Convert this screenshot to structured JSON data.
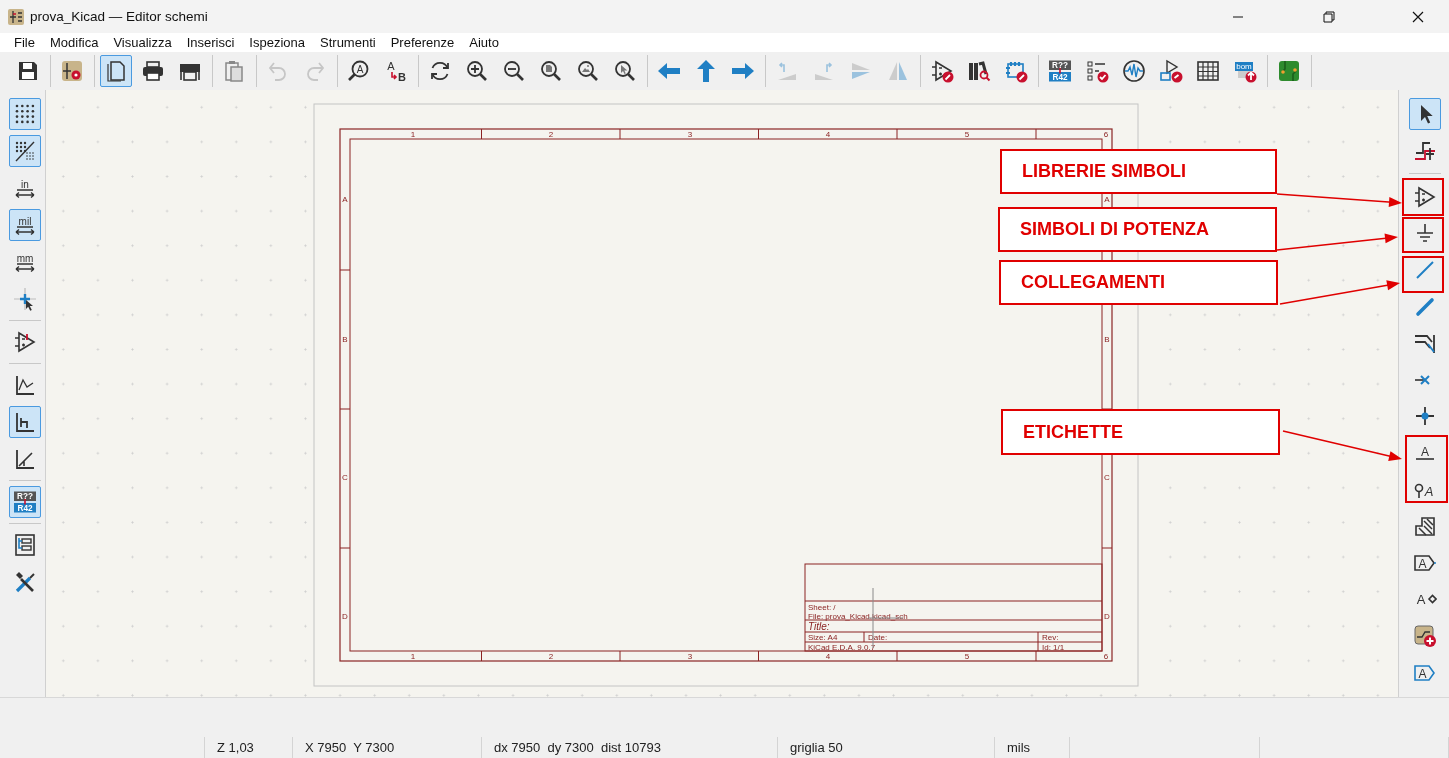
{
  "window": {
    "title": "prova_Kicad — Editor schemi"
  },
  "menu": [
    "File",
    "Modifica",
    "Visualizza",
    "Inserisci",
    "Ispeziona",
    "Strumenti",
    "Preferenze",
    "Aiuto"
  ],
  "toolbar": [
    {
      "kind": "save",
      "selected": false,
      "disabled": false
    },
    {
      "kind": "separator"
    },
    {
      "kind": "setup",
      "selected": false,
      "disabled": false
    },
    {
      "kind": "separator"
    },
    {
      "kind": "page",
      "selected": true,
      "disabled": false
    },
    {
      "kind": "print",
      "selected": false,
      "disabled": false
    },
    {
      "kind": "plot",
      "selected": false,
      "disabled": false
    },
    {
      "kind": "separator"
    },
    {
      "kind": "paste",
      "selected": false,
      "disabled": false
    },
    {
      "kind": "separator"
    },
    {
      "kind": "undo",
      "selected": false,
      "disabled": true
    },
    {
      "kind": "redo",
      "selected": false,
      "disabled": true
    },
    {
      "kind": "separator"
    },
    {
      "kind": "find",
      "selected": false,
      "disabled": false,
      "glyphs": [
        "A"
      ]
    },
    {
      "kind": "replace",
      "selected": false,
      "disabled": false,
      "glyphs": [
        "A",
        "B"
      ]
    },
    {
      "kind": "separator"
    },
    {
      "kind": "refresh",
      "selected": false,
      "disabled": false
    },
    {
      "kind": "zoom-in",
      "selected": false,
      "disabled": false
    },
    {
      "kind": "zoom-out",
      "selected": false,
      "disabled": false
    },
    {
      "kind": "zoom-fit",
      "selected": false,
      "disabled": false
    },
    {
      "kind": "zoom-objects",
      "selected": false,
      "disabled": false
    },
    {
      "kind": "zoom-selection",
      "selected": false,
      "disabled": false
    },
    {
      "kind": "separator"
    },
    {
      "kind": "pan-left",
      "selected": false,
      "disabled": false
    },
    {
      "kind": "pan-up",
      "selected": false,
      "disabled": false
    },
    {
      "kind": "pan-right",
      "selected": false,
      "disabled": false
    },
    {
      "kind": "separator"
    },
    {
      "kind": "rotate-ccw",
      "selected": false,
      "disabled": true
    },
    {
      "kind": "rotate-cw",
      "selected": false,
      "disabled": true
    },
    {
      "kind": "mirror-h",
      "selected": false,
      "disabled": true
    },
    {
      "kind": "mirror-v",
      "selected": false,
      "disabled": true
    },
    {
      "kind": "separator"
    },
    {
      "kind": "symbol-editor",
      "selected": false,
      "disabled": false
    },
    {
      "kind": "library-browser",
      "selected": false,
      "disabled": false
    },
    {
      "kind": "footprint-editor",
      "selected": false,
      "disabled": false
    },
    {
      "kind": "separator"
    },
    {
      "kind": "annotate",
      "selected": false,
      "disabled": false,
      "glyphs": [
        "R??",
        "R42"
      ]
    },
    {
      "kind": "erc",
      "selected": false,
      "disabled": false
    },
    {
      "kind": "simulator",
      "selected": false,
      "disabled": false
    },
    {
      "kind": "assign-footprints",
      "selected": false,
      "disabled": false
    },
    {
      "kind": "fields-table",
      "selected": false,
      "disabled": false
    },
    {
      "kind": "bom",
      "selected": false,
      "disabled": false,
      "glyphs": [
        "bom"
      ]
    },
    {
      "kind": "separator"
    },
    {
      "kind": "pcb",
      "selected": false,
      "disabled": false
    },
    {
      "kind": "separator"
    }
  ],
  "left_toolbar": [
    {
      "kind": "grid",
      "selected": true,
      "disabled": false
    },
    {
      "kind": "grid-overrides",
      "selected": true,
      "disabled": false
    },
    {
      "kind": "unit-in",
      "selected": false,
      "disabled": false,
      "glyphs": [
        "in"
      ]
    },
    {
      "kind": "unit-mil",
      "selected": true,
      "disabled": false,
      "glyphs": [
        "mil"
      ]
    },
    {
      "kind": "unit-mm",
      "selected": false,
      "disabled": false,
      "glyphs": [
        "mm"
      ]
    },
    {
      "kind": "cursor-full",
      "selected": false,
      "disabled": false
    },
    {
      "kind": "separator"
    },
    {
      "kind": "pin-highlight",
      "selected": false,
      "disabled": false
    },
    {
      "kind": "separator"
    },
    {
      "kind": "line-free",
      "selected": false,
      "disabled": false
    },
    {
      "kind": "line-90",
      "selected": true,
      "disabled": false
    },
    {
      "kind": "line-45",
      "selected": false,
      "disabled": false
    },
    {
      "kind": "separator"
    },
    {
      "kind": "annotate",
      "selected": true,
      "disabled": false,
      "glyphs": [
        "R??",
        "R42"
      ]
    },
    {
      "kind": "separator"
    },
    {
      "kind": "hierarchy",
      "selected": false,
      "disabled": false
    },
    {
      "kind": "tools",
      "selected": false,
      "disabled": false
    }
  ],
  "right_toolbar": [
    {
      "kind": "select",
      "selected": true,
      "disabled": false
    },
    {
      "kind": "highlight-net",
      "selected": false,
      "disabled": false
    },
    {
      "kind": "separator"
    },
    {
      "kind": "symbol",
      "selected": false,
      "disabled": false
    },
    {
      "kind": "power",
      "selected": false,
      "disabled": false
    },
    {
      "kind": "wire",
      "selected": false,
      "disabled": false
    },
    {
      "kind": "bus",
      "selected": false,
      "disabled": false
    },
    {
      "kind": "bus-entry",
      "selected": false,
      "disabled": false
    },
    {
      "kind": "no-connect",
      "selected": false,
      "disabled": false
    },
    {
      "kind": "junction",
      "selected": false,
      "disabled": false
    },
    {
      "kind": "label",
      "selected": false,
      "disabled": false,
      "glyphs": [
        "A"
      ]
    },
    {
      "kind": "directive",
      "selected": false,
      "disabled": false,
      "glyphs": [
        "A"
      ]
    },
    {
      "kind": "sheet",
      "selected": false,
      "disabled": false
    },
    {
      "kind": "global-label",
      "selected": false,
      "disabled": false,
      "glyphs": [
        "A"
      ]
    },
    {
      "kind": "pin-label",
      "selected": false,
      "disabled": false,
      "glyphs": [
        "A"
      ]
    },
    {
      "kind": "sheet-import",
      "selected": false,
      "disabled": false
    },
    {
      "kind": "hier-label",
      "selected": false,
      "disabled": false,
      "glyphs": [
        "A"
      ]
    }
  ],
  "sheet": {
    "top_zones": [
      "1",
      "2",
      "3",
      "4",
      "5",
      "6"
    ],
    "bottom_zones": [
      "1",
      "2",
      "3",
      "4",
      "5",
      "6"
    ],
    "left_zones": [
      "A",
      "B",
      "C",
      "D"
    ],
    "right_zones": [
      "A",
      "B",
      "C",
      "D"
    ],
    "title_block": {
      "sheet": "Sheet: /",
      "file": "File: prova_Kicad.kicad_sch",
      "title": "Title:",
      "size": "Size: A4",
      "date": "Date:",
      "rev": "Rev:",
      "generator": "KiCad E.D.A. 9.0.7",
      "id": "Id: 1/1"
    }
  },
  "callouts": [
    {
      "label": "LIBRERIE SIMBOLI"
    },
    {
      "label": "SIMBOLI DI POTENZA"
    },
    {
      "label": "COLLEGAMENTI"
    },
    {
      "label": "ETICHETTE"
    }
  ],
  "status_bar": [
    "Z 1,03",
    "X 7950  Y 7300",
    "dx 7950  dy 7300  dist 10793",
    "griglia 50",
    "mils"
  ]
}
